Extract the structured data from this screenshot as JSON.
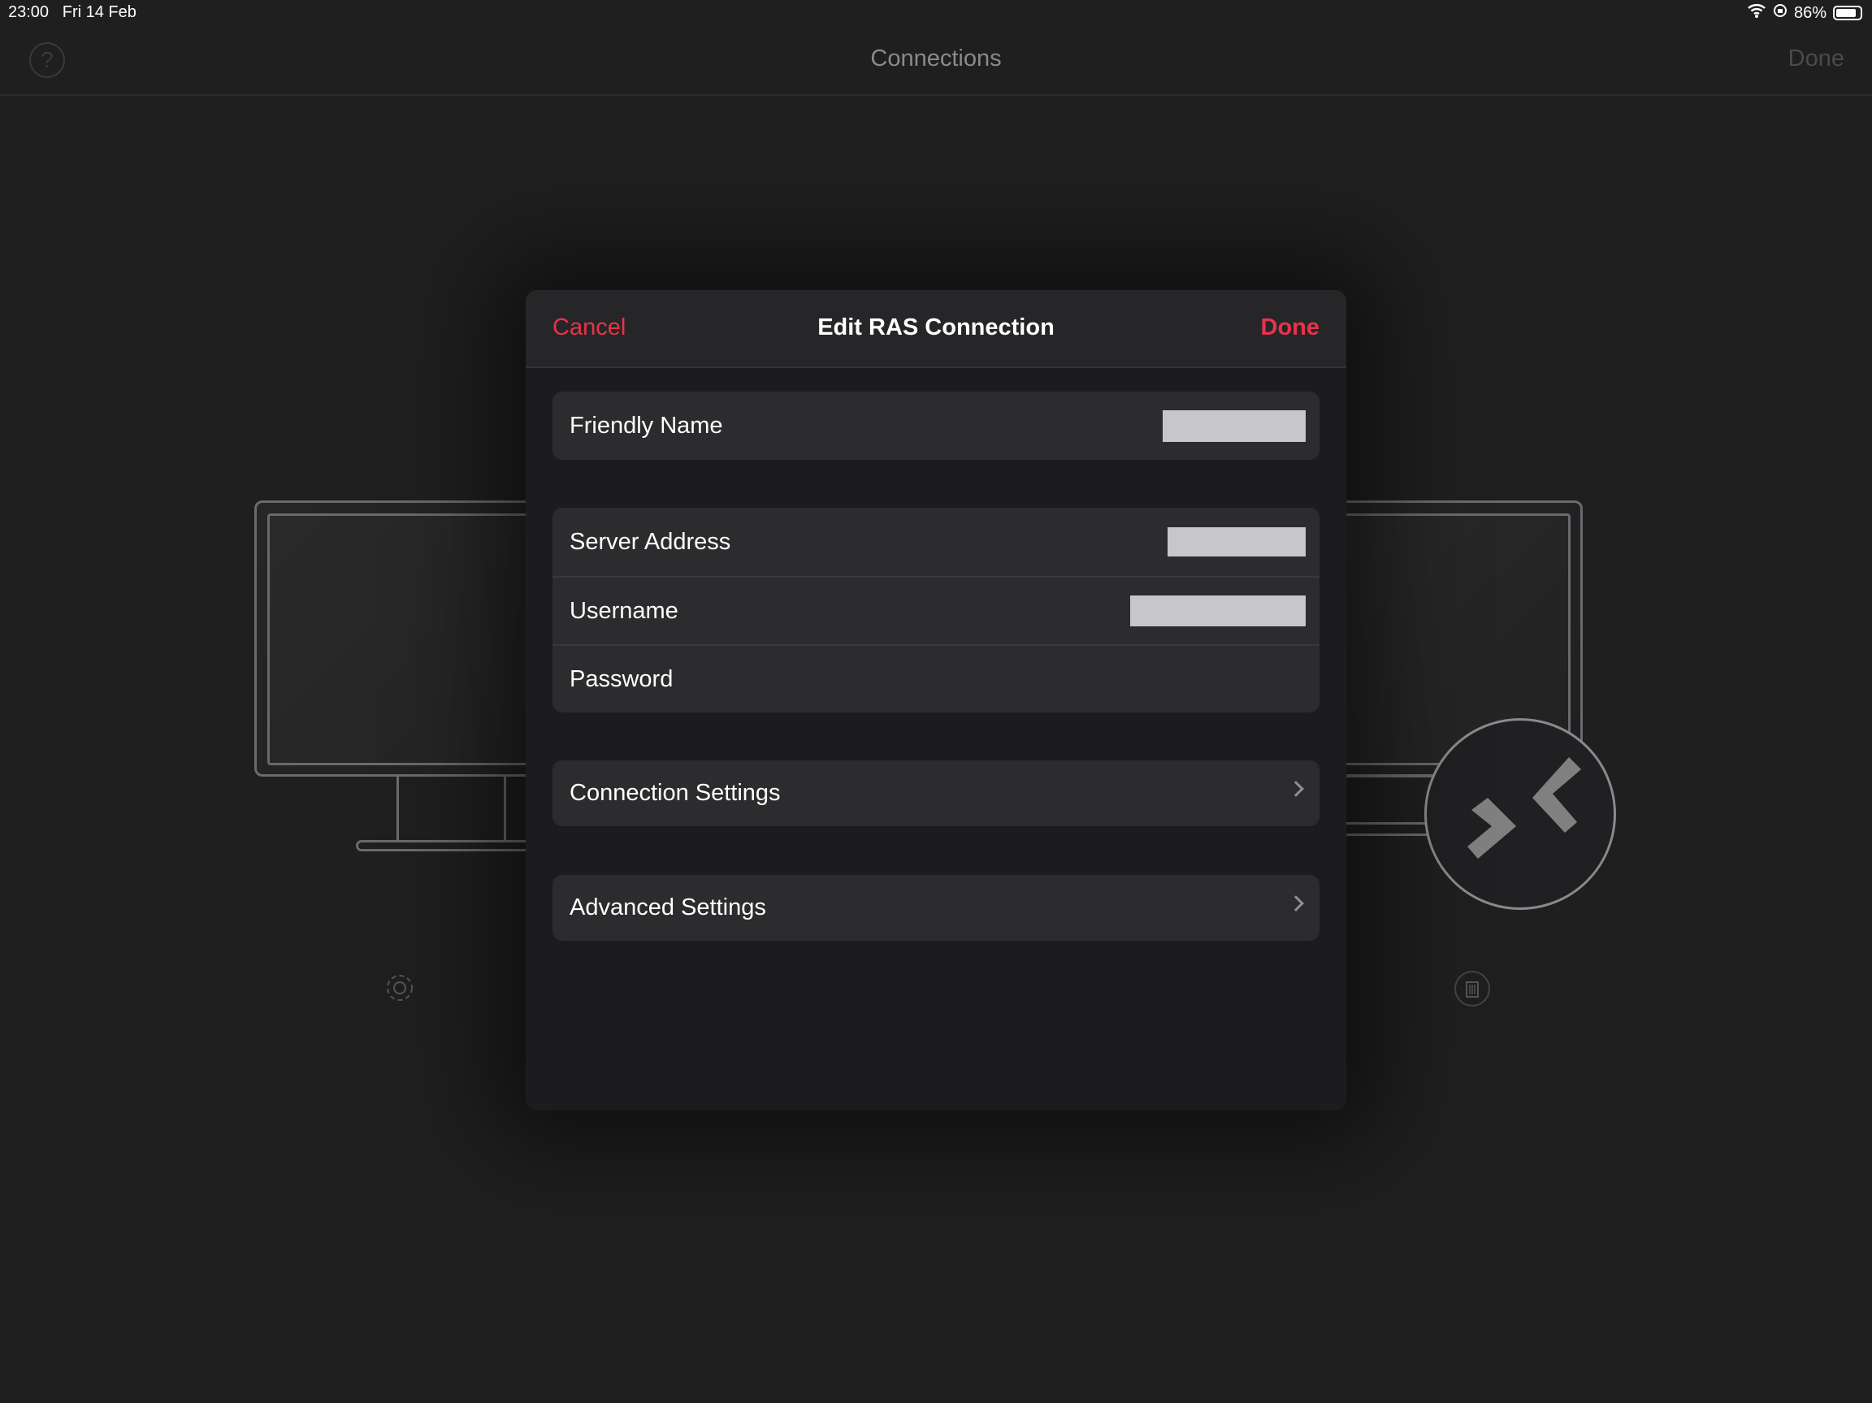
{
  "status_bar": {
    "time": "23:00",
    "date": "Fri 14 Feb",
    "battery": "86%",
    "battery_level": 0.86
  },
  "nav": {
    "title": "Connections",
    "done": "Done",
    "help_icon": "?"
  },
  "modal": {
    "cancel": "Cancel",
    "title": "Edit RAS Connection",
    "done": "Done",
    "fields": {
      "friendly_name": "Friendly Name",
      "server_address": "Server Address",
      "username": "Username",
      "password": "Password"
    },
    "connection_settings": "Connection Settings",
    "advanced_settings": "Advanced Settings"
  },
  "colors": {
    "accent": "#e8334a",
    "background": "#1f1f20",
    "row": "#2c2c2e"
  }
}
